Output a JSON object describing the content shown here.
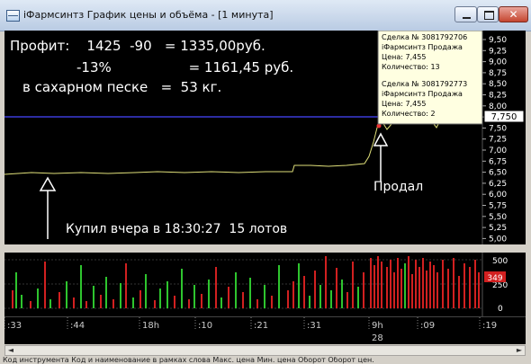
{
  "window": {
    "title": "iФармсинтз График цены и объёма - [1 минута]"
  },
  "overlay": {
    "line1": "Профит:    1425  -90   = 1335,00руб.",
    "line2": "-13%                  = 1161,45 руб.",
    "line3": "в сахарном песке   =  53 кг.",
    "buy_note": "Купил вчера в 18:30:27  15 лотов",
    "sell_note": "Продал"
  },
  "tooltip": {
    "trades": [
      {
        "deal": "Сделка № 3081792706",
        "instrument": "iФармсинтз Продажа",
        "price": "Цена: 7,455",
        "qty": "Количество: 13"
      },
      {
        "deal": "Сделка № 3081792773",
        "instrument": "iФармсинтз Продажа",
        "price": "Цена: 7,455",
        "qty": "Количество: 2"
      }
    ]
  },
  "price_axis": {
    "ticks": [
      "9,50",
      "9,25",
      "9,00",
      "8,75",
      "8,50",
      "8,25",
      "8,00",
      "7,75",
      "7,50",
      "7,25",
      "7,00",
      "6,75",
      "6,50",
      "6,25",
      "6,00",
      "5,75",
      "5,50",
      "5,25",
      "5,00"
    ],
    "current": "7,750"
  },
  "volume_axis": {
    "ticks": [
      "500",
      "250",
      "0"
    ],
    "current": "349"
  },
  "time_axis": {
    "labels": [
      ":33",
      ":44",
      "18h",
      ":10",
      ":21",
      ":31",
      "9h",
      ":09",
      ":19"
    ],
    "date": "28"
  },
  "bottom": {
    "partial_header": "Код инструмента   Код и наименование в рамках слова   Макс. цена   Мин. цена   Оборот   Оборот цен."
  },
  "colors": {
    "price_line": "#e0e07a",
    "current_price_line": "#3a3ad8",
    "buy_vol": "#2ec52e",
    "sell_vol": "#d22020",
    "tooltip_bg": "#ffffe1",
    "volume_badge": "#d22020"
  }
}
